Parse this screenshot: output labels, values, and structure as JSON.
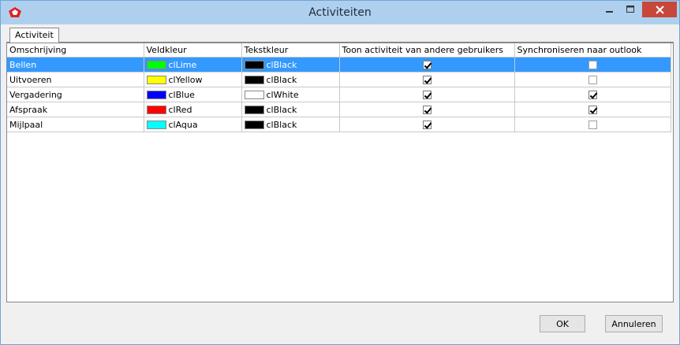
{
  "window": {
    "title": "Activiteiten"
  },
  "tabs": [
    {
      "label": "Activiteit"
    }
  ],
  "table": {
    "columns": [
      "Omschrijving",
      "Veldkleur",
      "Tekstkleur",
      "Toon activiteit van andere gebruikers",
      "Synchroniseren naar outlook"
    ],
    "rows": [
      {
        "omschrijving": "Bellen",
        "veldkleur": "clLime",
        "veldkleur_hex": "#00ff00",
        "tekstkleur": "clBlack",
        "tekstkleur_hex": "#000000",
        "toon": true,
        "sync": false,
        "selected": true
      },
      {
        "omschrijving": "Uitvoeren",
        "veldkleur": "clYellow",
        "veldkleur_hex": "#ffff00",
        "tekstkleur": "clBlack",
        "tekstkleur_hex": "#000000",
        "toon": true,
        "sync": false,
        "selected": false
      },
      {
        "omschrijving": "Vergadering",
        "veldkleur": "clBlue",
        "veldkleur_hex": "#0000ff",
        "tekstkleur": "clWhite",
        "tekstkleur_hex": "#ffffff",
        "toon": true,
        "sync": true,
        "selected": false
      },
      {
        "omschrijving": "Afspraak",
        "veldkleur": "clRed",
        "veldkleur_hex": "#ff0000",
        "tekstkleur": "clBlack",
        "tekstkleur_hex": "#000000",
        "toon": true,
        "sync": true,
        "selected": false
      },
      {
        "omschrijving": "Mijlpaal",
        "veldkleur": "clAqua",
        "veldkleur_hex": "#00ffff",
        "tekstkleur": "clBlack",
        "tekstkleur_hex": "#000000",
        "toon": true,
        "sync": false,
        "selected": false
      }
    ]
  },
  "buttons": {
    "ok": "OK",
    "cancel": "Annuleren"
  },
  "colors": {
    "selection": "#3399ff",
    "titlebar": "#aed0ee",
    "close": "#c7473b"
  }
}
